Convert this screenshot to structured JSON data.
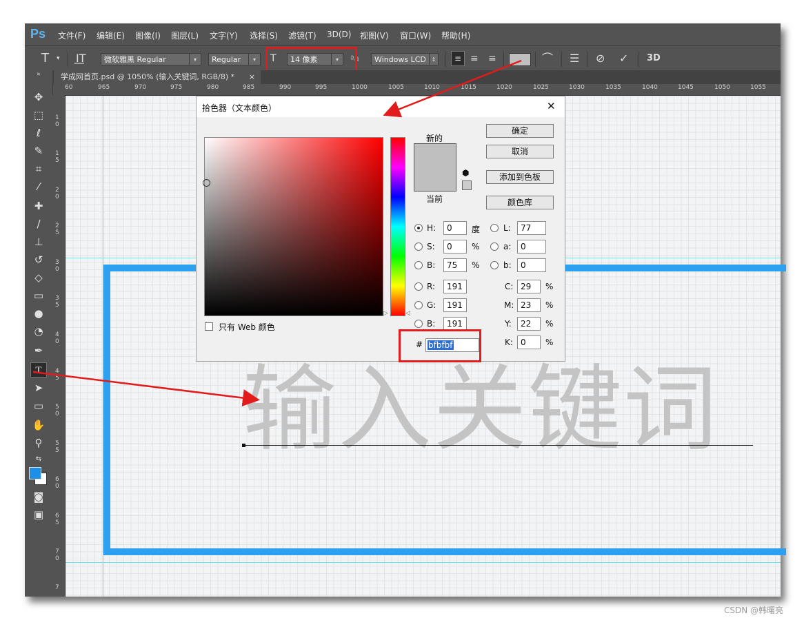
{
  "app": {
    "logo": "Ps"
  },
  "menu": [
    "文件(F)",
    "编辑(E)",
    "图像(I)",
    "图层(L)",
    "文字(Y)",
    "选择(S)",
    "滤镜(T)",
    "3D(D)",
    "视图(V)",
    "窗口(W)",
    "帮助(H)"
  ],
  "options": {
    "tool_glyph": "T",
    "font_family": "微软雅黑 Regular",
    "font_style": "Regular",
    "font_size": "14 像素",
    "aa_label": "ªa",
    "antialias": "Windows LCD",
    "threeD": "3D"
  },
  "document_tab": {
    "title": "学成网首页.psd @ 1050% (输入关键词, RGB/8) *",
    "close": "×"
  },
  "ruler_top": [
    "60",
    "965",
    "970",
    "975",
    "980",
    "985",
    "990",
    "995",
    "1000",
    "1005",
    "1010",
    "1015",
    "1020",
    "1025",
    "1030",
    "1035",
    "1040",
    "1045",
    "1050",
    "1055"
  ],
  "ruler_left": [
    "1 0",
    "1 5",
    "2 0",
    "2 5",
    "3 0",
    "3 5",
    "4 0",
    "4 5",
    "5 0",
    "5 5",
    "6 0",
    "6 5",
    "7 0",
    "7"
  ],
  "canvas_text": "输入关键词",
  "dialog": {
    "title": "拾色器（文本颜色）",
    "close": "✕",
    "new_label": "新的",
    "current_label": "当前",
    "buttons": {
      "ok": "确定",
      "cancel": "取消",
      "add_swatch": "添加到色板",
      "libraries": "颜色库"
    },
    "web_only": "只有 Web 颜色",
    "hsb": {
      "H": "0",
      "S": "0",
      "B": "75",
      "h_unit": "度",
      "pct": "%"
    },
    "lab": {
      "L": "77",
      "a": "0",
      "b": "0"
    },
    "rgb": {
      "R": "191",
      "G": "191",
      "B": "191"
    },
    "cmyk": {
      "C": "29",
      "M": "23",
      "Y": "22",
      "K": "0",
      "pct": "%"
    },
    "hex_prefix": "#",
    "hex": "bfbfbf",
    "labels": {
      "H": "H:",
      "S": "S:",
      "B": "B:",
      "L": "L:",
      "a": "a:",
      "b": "b:",
      "R": "R:",
      "G": "G:",
      "B2": "B:",
      "C": "C:",
      "M": "M:",
      "Y": "Y:",
      "K": "K:"
    }
  },
  "colors": {
    "new_color": "#bfbfbf",
    "foreground": "#1e8fe8",
    "accent_blue": "#2da0f0",
    "annotation_red": "#e21c1c"
  },
  "watermark": "CSDN @韩曙亮"
}
